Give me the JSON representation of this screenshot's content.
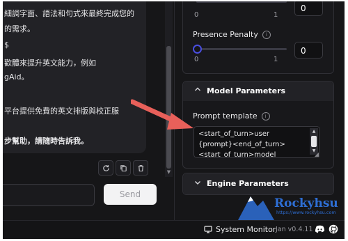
{
  "chat": {
    "lines": [
      "細調字面、語法和句式來最終完成您的",
      "的需求。",
      "$",
      "歡體來提升英文能力，例如",
      "gAid。",
      "平台提供免費的英文排版與校正服",
      "步幫助，請隨時告訴我。"
    ],
    "send_label": "Send",
    "action_icons": [
      "refresh-icon",
      "copy-icon",
      "delete-icon"
    ]
  },
  "settings": {
    "top_slider": {
      "min_label": "0",
      "max_label": "1",
      "value": "0"
    },
    "presence_penalty": {
      "label": "Presence Penalty",
      "min_label": "0",
      "max_label": "1",
      "value": "0"
    },
    "model_parameters": {
      "title": "Model Parameters",
      "prompt_template_label": "Prompt template",
      "prompt_template_lines": [
        "<start_of_turn>user",
        "{prompt}<end_of_turn>",
        "<start_of_turn>model"
      ]
    },
    "engine_parameters": {
      "title": "Engine Parameters"
    }
  },
  "status_bar": {
    "system_monitor": "System Monitor",
    "version": "Jan v0.4.11"
  },
  "watermark": {
    "text": "Rockyhsu",
    "url": "https://www.rockyhsu.com"
  },
  "colors": {
    "background": "#161618",
    "panel_card": "#18181b",
    "accent": "#4a4ee0",
    "arrow": "#e8605a",
    "watermark": "#2e6fd6"
  }
}
